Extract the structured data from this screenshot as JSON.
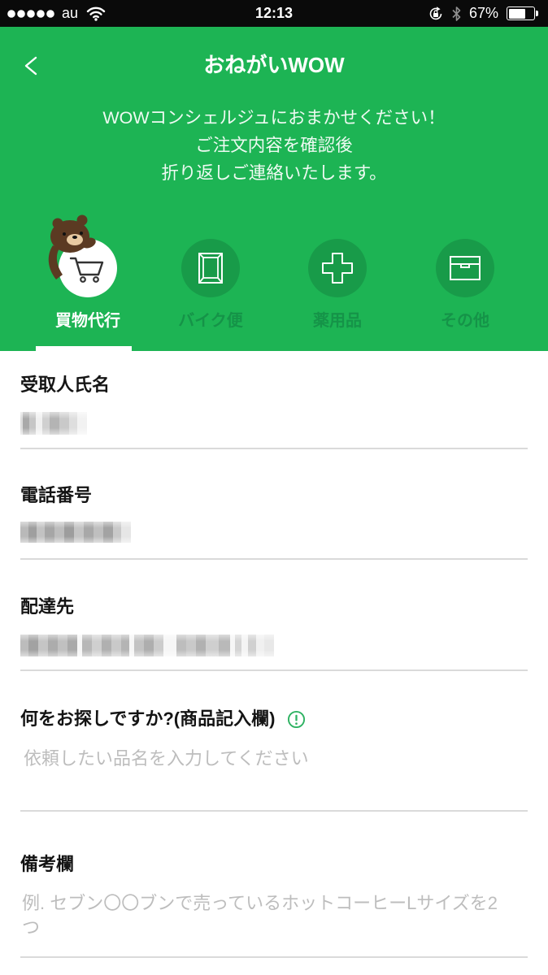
{
  "status_bar": {
    "signal_dots_total": 5,
    "signal_dots_filled": 5,
    "carrier": "au",
    "wifi_icon": "wifi-icon",
    "time": "12:13",
    "rotation_lock_icon": "rotation-lock-icon",
    "bluetooth_icon": "bluetooth-icon",
    "battery_text": "67%",
    "battery_level": 0.67
  },
  "header": {
    "back_icon": "chevron-left-icon",
    "title": "おねがいWOW",
    "subtitle_lines": [
      "WOWコンシェルジュにおまかせください！",
      "ご注文内容を確認後",
      "折り返しご連絡いたします。"
    ]
  },
  "categories": [
    {
      "label": "買物代行",
      "icon": "shopping-cart-icon",
      "mascot_icon": "brown-bear-icon",
      "active": true
    },
    {
      "label": "バイク便",
      "icon": "envelope-icon",
      "active": false
    },
    {
      "label": "薬用品",
      "icon": "medical-cross-icon",
      "active": false
    },
    {
      "label": "その他",
      "icon": "box-icon",
      "active": false
    }
  ],
  "form": {
    "recipient_name": {
      "label": "受取人氏名"
    },
    "phone": {
      "label": "電話番号"
    },
    "address": {
      "label": "配達先"
    },
    "item_request": {
      "label": "何をお探しですか?(商品記入欄)",
      "info_icon": "exclamation-circle-icon",
      "placeholder": "依頼したい品名を入力してください"
    },
    "notes": {
      "label": "備考欄",
      "placeholder": "例. セブン〇〇ブンで売っているホットコーヒーLサイズを2つ"
    }
  },
  "colors": {
    "brand_green": "#1db454",
    "inactive_tab_green": "#189b49",
    "inactive_label_green": "#159348",
    "placeholder_gray": "#bdbdbd",
    "info_green": "#2eb262"
  }
}
